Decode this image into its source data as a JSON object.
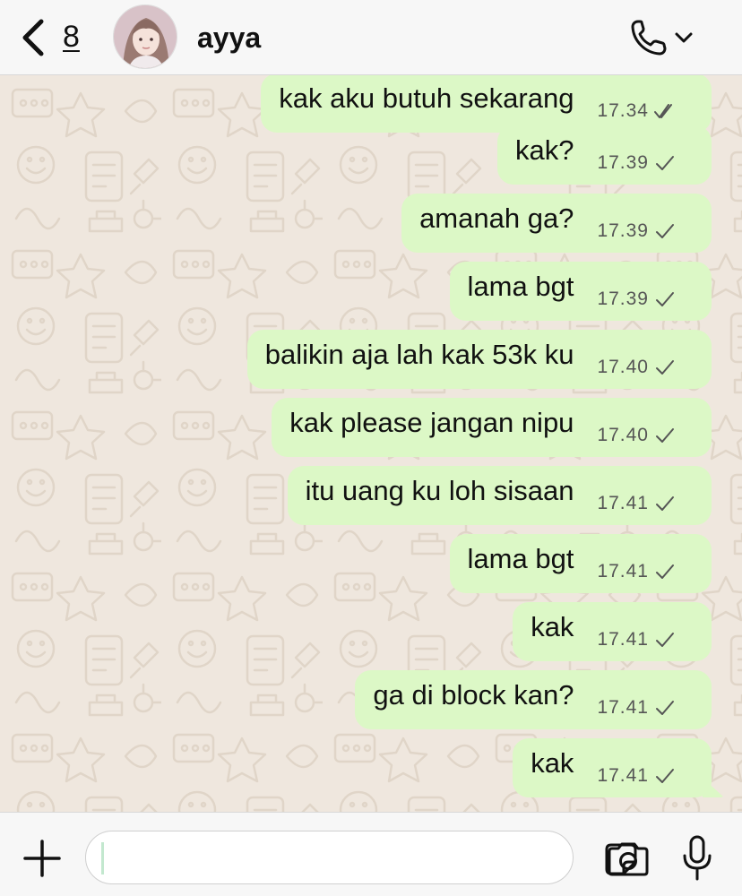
{
  "header": {
    "back_count": "8",
    "contact_name": "ayya"
  },
  "messages": [
    {
      "text": "kak aku butuh sekarang",
      "time": "17.34",
      "status": "read"
    },
    {
      "text": "kak?",
      "time": "17.39",
      "status": "sent"
    },
    {
      "text": "amanah ga?",
      "time": "17.39",
      "status": "sent"
    },
    {
      "text": "lama bgt",
      "time": "17.39",
      "status": "sent"
    },
    {
      "text": "balikin aja lah kak 53k ku",
      "time": "17.40",
      "status": "sent"
    },
    {
      "text": "kak please jangan nipu",
      "time": "17.40",
      "status": "sent"
    },
    {
      "text": "itu uang ku loh sisaan",
      "time": "17.41",
      "status": "sent"
    },
    {
      "text": "lama bgt",
      "time": "17.41",
      "status": "sent"
    },
    {
      "text": "kak",
      "time": "17.41",
      "status": "sent"
    },
    {
      "text": "ga di block kan?",
      "time": "17.41",
      "status": "sent"
    },
    {
      "text": "kak",
      "time": "17.41",
      "status": "sent"
    }
  ],
  "input": {
    "value": "",
    "placeholder": ""
  },
  "icons": {
    "back": "chevron-left-icon",
    "call": "phone-icon",
    "call_menu": "chevron-down-icon",
    "attach": "plus-icon",
    "sticker": "sticker-icon",
    "camera": "camera-icon",
    "mic": "microphone-icon"
  },
  "colors": {
    "outgoing_bubble": "#dcf8c6",
    "chat_background": "#efe7de",
    "bar_background": "#f7f7f7"
  }
}
